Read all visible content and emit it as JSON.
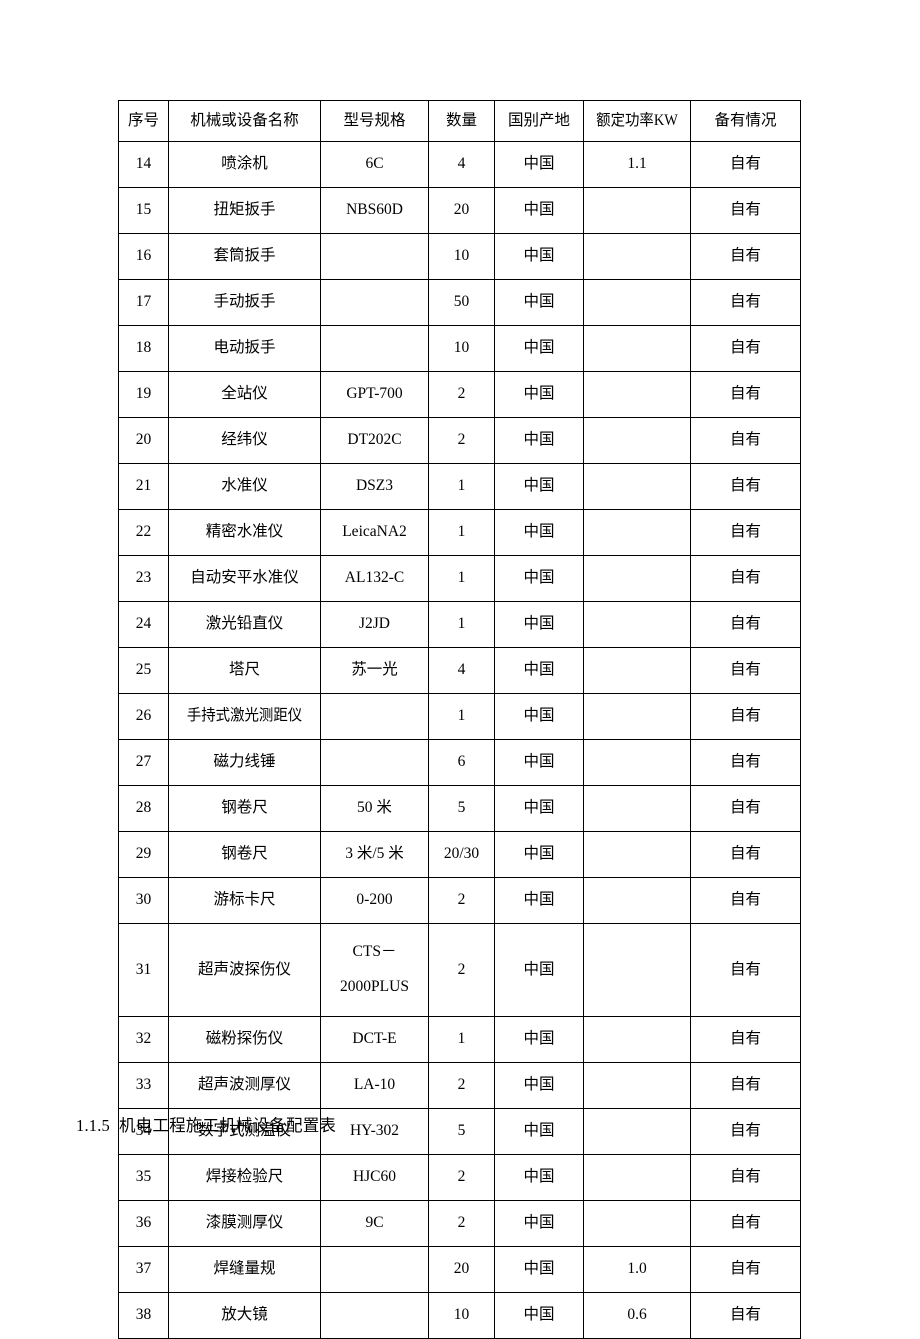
{
  "table": {
    "headers": [
      "序号",
      "机械或设备名称",
      "型号规格",
      "数量",
      "国别产地",
      "额定功率KW",
      "备有情况"
    ],
    "rows": [
      {
        "idx": "14",
        "name": "喷涂机",
        "spec": "6C",
        "qty": "4",
        "origin": "中国",
        "power": "1.1",
        "own": "自有"
      },
      {
        "idx": "15",
        "name": "扭矩扳手",
        "spec": "NBS60D",
        "qty": "20",
        "origin": "中国",
        "power": "",
        "own": "自有"
      },
      {
        "idx": "16",
        "name": "套筒扳手",
        "spec": "",
        "qty": "10",
        "origin": "中国",
        "power": "",
        "own": "自有"
      },
      {
        "idx": "17",
        "name": "手动扳手",
        "spec": "",
        "qty": "50",
        "origin": "中国",
        "power": "",
        "own": "自有"
      },
      {
        "idx": "18",
        "name": "电动扳手",
        "spec": "",
        "qty": "10",
        "origin": "中国",
        "power": "",
        "own": "自有"
      },
      {
        "idx": "19",
        "name": "全站仪",
        "spec": "GPT-700",
        "qty": "2",
        "origin": "中国",
        "power": "",
        "own": "自有"
      },
      {
        "idx": "20",
        "name": "经纬仪",
        "spec": "DT202C",
        "qty": "2",
        "origin": "中国",
        "power": "",
        "own": "自有"
      },
      {
        "idx": "21",
        "name": "水准仪",
        "spec": "DSZ3",
        "qty": "1",
        "origin": "中国",
        "power": "",
        "own": "自有"
      },
      {
        "idx": "22",
        "name": "精密水准仪",
        "spec": "LeicaNA2",
        "qty": "1",
        "origin": "中国",
        "power": "",
        "own": "自有"
      },
      {
        "idx": "23",
        "name": "自动安平水准仪",
        "spec": "AL132-C",
        "qty": "1",
        "origin": "中国",
        "power": "",
        "own": "自有"
      },
      {
        "idx": "24",
        "name": "激光铅直仪",
        "spec": "J2JD",
        "qty": "1",
        "origin": "中国",
        "power": "",
        "own": "自有"
      },
      {
        "idx": "25",
        "name": "塔尺",
        "spec": "苏一光",
        "qty": "4",
        "origin": "中国",
        "power": "",
        "own": "自有"
      },
      {
        "idx": "26",
        "name": "手持式激光测距仪",
        "spec": "",
        "qty": "1",
        "origin": "中国",
        "power": "",
        "own": "自有"
      },
      {
        "idx": "27",
        "name": "磁力线锤",
        "spec": "",
        "qty": "6",
        "origin": "中国",
        "power": "",
        "own": "自有"
      },
      {
        "idx": "28",
        "name": "钢卷尺",
        "spec": "50 米",
        "qty": "5",
        "origin": "中国",
        "power": "",
        "own": "自有"
      },
      {
        "idx": "29",
        "name": "钢卷尺",
        "spec": "3 米/5 米",
        "qty": "20/30",
        "origin": "中国",
        "power": "",
        "own": "自有"
      },
      {
        "idx": "30",
        "name": "游标卡尺",
        "spec": "0-200",
        "qty": "2",
        "origin": "中国",
        "power": "",
        "own": "自有"
      },
      {
        "idx": "31",
        "name": "超声波探伤仪",
        "spec": "CTS－2000PLUS",
        "spec_line1": "CTS－",
        "spec_line2": "2000PLUS",
        "qty": "2",
        "origin": "中国",
        "power": "",
        "own": "自有",
        "tall": true
      },
      {
        "idx": "32",
        "name": "磁粉探伤仪",
        "spec": "DCT-E",
        "qty": "1",
        "origin": "中国",
        "power": "",
        "own": "自有"
      },
      {
        "idx": "33",
        "name": "超声波测厚仪",
        "spec": "LA-10",
        "qty": "2",
        "origin": "中国",
        "power": "",
        "own": "自有"
      },
      {
        "idx": "34",
        "name": "数字式测温仪",
        "spec": "HY-302",
        "qty": "5",
        "origin": "中国",
        "power": "",
        "own": "自有"
      },
      {
        "idx": "35",
        "name": "焊接检验尺",
        "spec": "HJC60",
        "qty": "2",
        "origin": "中国",
        "power": "",
        "own": "自有"
      },
      {
        "idx": "36",
        "name": "漆膜测厚仪",
        "spec": "9C",
        "qty": "2",
        "origin": "中国",
        "power": "",
        "own": "自有"
      },
      {
        "idx": "37",
        "name": "焊缝量规",
        "spec": "",
        "qty": "20",
        "origin": "中国",
        "power": "1.0",
        "own": "自有"
      },
      {
        "idx": "38",
        "name": "放大镜",
        "spec": "",
        "qty": "10",
        "origin": "中国",
        "power": "0.6",
        "own": "自有"
      }
    ]
  },
  "caption": {
    "number": "1.1.5",
    "text": "机电工程施工机械设备配置表"
  }
}
